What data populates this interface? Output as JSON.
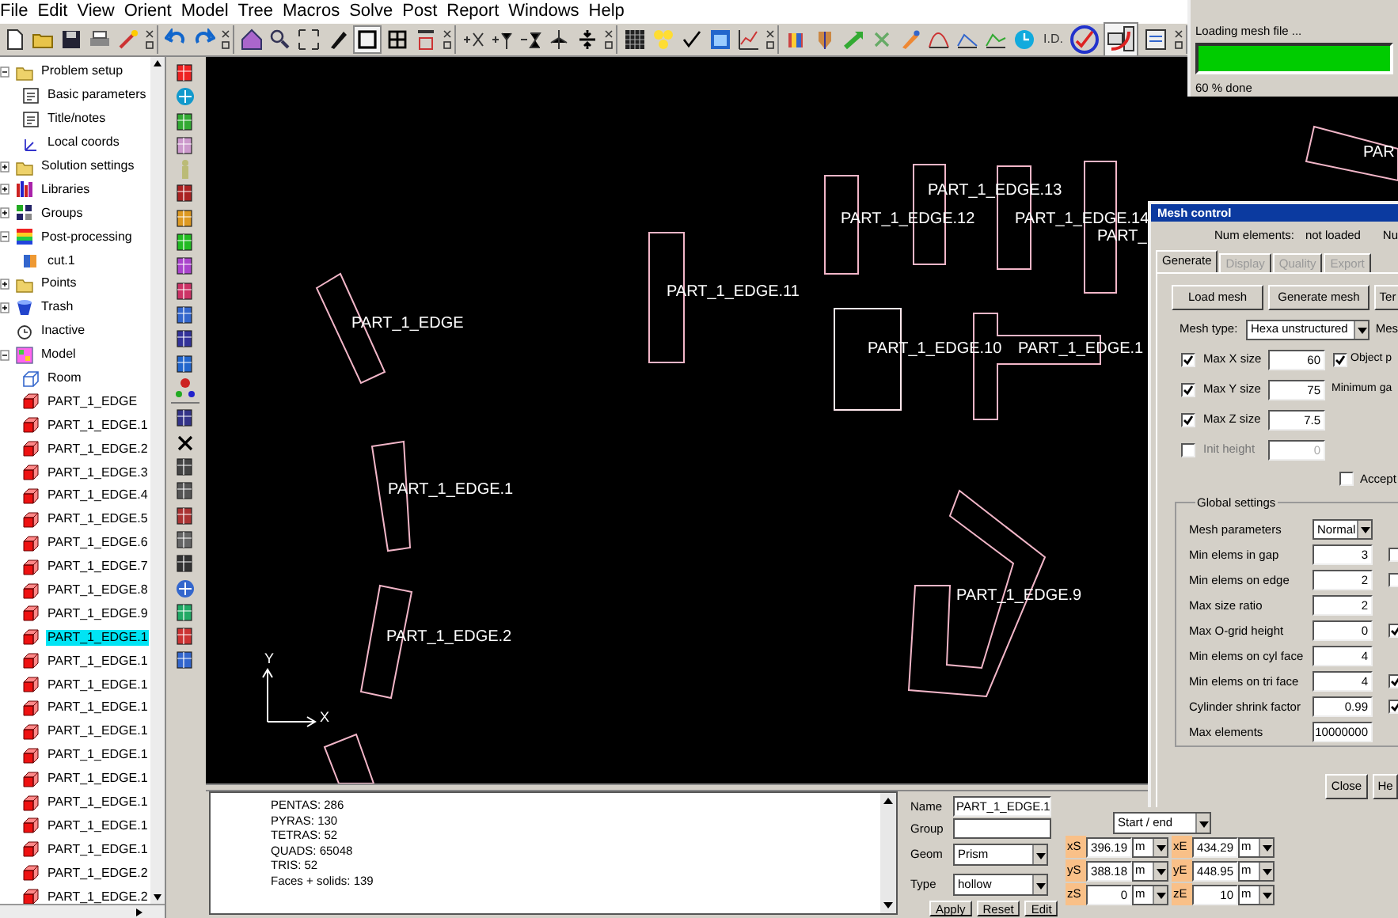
{
  "menu": [
    "File",
    "Edit",
    "View",
    "Orient",
    "Model",
    "Tree",
    "Macros",
    "Solve",
    "Post",
    "Report",
    "Windows",
    "Help"
  ],
  "toolbar": {
    "text_button": "I.D."
  },
  "progress": {
    "title": "Loading mesh file ...",
    "level": 1,
    "status": "60 % done"
  },
  "tree": [
    {
      "label": "Problem setup",
      "kind": "folder",
      "expanded": true,
      "selected": false,
      "children": [
        {
          "label": "Basic parameters",
          "kind": "page",
          "selected": false
        },
        {
          "label": "Title/notes",
          "kind": "page",
          "selected": false
        },
        {
          "label": "Local coords",
          "kind": "axes",
          "selected": false
        }
      ]
    },
    {
      "label": "Solution settings",
      "kind": "folder",
      "expanded": false,
      "selected": false
    },
    {
      "label": "Libraries",
      "kind": "books",
      "expanded": false,
      "selected": false
    },
    {
      "label": "Groups",
      "kind": "groups",
      "expanded": false,
      "selected": false
    },
    {
      "label": "Post-processing",
      "kind": "colormap",
      "expanded": true,
      "selected": false,
      "children": [
        {
          "label": "cut.1",
          "kind": "cut",
          "selected": false
        }
      ]
    },
    {
      "label": "Points",
      "kind": "folder",
      "expanded": false,
      "selected": false
    },
    {
      "label": "Trash",
      "kind": "trash",
      "expanded": false,
      "selected": false
    },
    {
      "label": "Inactive",
      "kind": "inactive",
      "selected": false
    },
    {
      "label": "Model",
      "kind": "model",
      "expanded": true,
      "selected": false,
      "children": [
        {
          "label": "Room",
          "kind": "room",
          "selected": false
        },
        {
          "label": "PART_1_EDGE",
          "kind": "block",
          "selected": false
        },
        {
          "label": "PART_1_EDGE.1",
          "kind": "block",
          "selected": false
        },
        {
          "label": "PART_1_EDGE.2",
          "kind": "block",
          "selected": false
        },
        {
          "label": "PART_1_EDGE.3",
          "kind": "block",
          "selected": false
        },
        {
          "label": "PART_1_EDGE.4",
          "kind": "block",
          "selected": false
        },
        {
          "label": "PART_1_EDGE.5",
          "kind": "block",
          "selected": false
        },
        {
          "label": "PART_1_EDGE.6",
          "kind": "block",
          "selected": false
        },
        {
          "label": "PART_1_EDGE.7",
          "kind": "block",
          "selected": false
        },
        {
          "label": "PART_1_EDGE.8",
          "kind": "block",
          "selected": false
        },
        {
          "label": "PART_1_EDGE.9",
          "kind": "block",
          "selected": false
        },
        {
          "label": "PART_1_EDGE.1",
          "kind": "block",
          "selected": true
        },
        {
          "label": "PART_1_EDGE.1",
          "kind": "block",
          "selected": false
        },
        {
          "label": "PART_1_EDGE.1",
          "kind": "block",
          "selected": false
        },
        {
          "label": "PART_1_EDGE.1",
          "kind": "block",
          "selected": false
        },
        {
          "label": "PART_1_EDGE.1",
          "kind": "block",
          "selected": false
        },
        {
          "label": "PART_1_EDGE.1",
          "kind": "block",
          "selected": false
        },
        {
          "label": "PART_1_EDGE.1",
          "kind": "block",
          "selected": false
        },
        {
          "label": "PART_1_EDGE.1",
          "kind": "block",
          "selected": false
        },
        {
          "label": "PART_1_EDGE.1",
          "kind": "block",
          "selected": false
        },
        {
          "label": "PART_1_EDGE.1",
          "kind": "block",
          "selected": false
        },
        {
          "label": "PART_1_EDGE.2",
          "kind": "block",
          "selected": false
        },
        {
          "label": "PART_1_EDGE.2",
          "kind": "block",
          "selected": false
        }
      ]
    }
  ],
  "canvas": {
    "parts": [
      "PART_1_EDGE",
      "PART_1_EDGE.1",
      "PART_1_EDGE.2",
      "PART_1_EDGE.11",
      "PART_1_EDGE.12",
      "PART_1_EDGE.13",
      "PART_1_EDGE.14",
      "PART_1_EDGE.10",
      "PART_1_EDGE.1",
      "PART_1_EDGE.9",
      "PART_",
      "PAR"
    ],
    "axis_y": "Y",
    "axis_x": "X"
  },
  "mesh_control": {
    "title": "Mesh control",
    "num_elements_label": "Num elements:",
    "num_elements_value": "not loaded",
    "column_3": "Nu",
    "tabs": [
      {
        "label": "Generate",
        "selected": true,
        "disabled": false
      },
      {
        "label": "Display",
        "selected": false,
        "disabled": true
      },
      {
        "label": "Quality",
        "selected": false,
        "disabled": true
      },
      {
        "label": "Export",
        "selected": false,
        "disabled": true
      }
    ],
    "buttons": [
      "Load mesh",
      "Generate mesh",
      "Ter"
    ],
    "mesh_type": {
      "label": "Mesh type:",
      "value": "Hexa unstructured",
      "right_label": "Mes"
    },
    "size_rows": [
      {
        "label": "Max X size",
        "checked": true,
        "value": "60",
        "disabled": false
      },
      {
        "label": "Max Y size",
        "checked": true,
        "value": "75",
        "disabled": false
      },
      {
        "label": "Max Z size",
        "checked": true,
        "value": "7.5",
        "disabled": false
      },
      {
        "label": "Init height",
        "checked": false,
        "value": "0",
        "disabled": true
      }
    ],
    "object_checkbox": {
      "label": "Object p",
      "checked": true
    },
    "minimum_gap_label": "Minimum ga",
    "accept_checkbox": {
      "label": "Accept",
      "checked": false
    },
    "global_settings": {
      "title": "Global settings",
      "mesh_parameters": {
        "label": "Mesh parameters",
        "value": "Normal"
      },
      "rows": [
        {
          "label": "Min elems in gap",
          "value": "3",
          "side_checked": false
        },
        {
          "label": "Min elems on edge",
          "value": "2",
          "side_checked": false
        },
        {
          "label": "Max size ratio",
          "value": "2"
        },
        {
          "label": "Max O-grid height",
          "value": "0",
          "side_checked": true
        },
        {
          "label": "Min elems on cyl face",
          "value": "4"
        },
        {
          "label": "Min elems on tri face",
          "value": "4",
          "side_checked": true
        },
        {
          "label": "Cylinder shrink factor",
          "value": "0.99",
          "side_checked": true
        },
        {
          "label": "Max elements",
          "value": "10000000"
        }
      ]
    },
    "footer_buttons": [
      "Close",
      "He"
    ]
  },
  "messages": [
    "PENTAS: 286",
    "PYRAS: 130",
    "TETRAS: 52",
    "QUADS: 65048",
    "TRIS: 52",
    "Faces + solids: 139"
  ],
  "properties": {
    "name": {
      "label": "Name",
      "value": "PART_1_EDGE.1"
    },
    "group": {
      "label": "Group"
    },
    "geom": {
      "label": "Geom",
      "value": "Prism"
    },
    "type": {
      "label": "Type",
      "value": "hollow"
    },
    "buttons": [
      "Apply",
      "Reset",
      "Edit"
    ],
    "position_mode": "Start / end",
    "coords": [
      {
        "label": "xS",
        "value": "396.19",
        "unit": "m"
      },
      {
        "label": "xE",
        "value": "434.29",
        "unit": "m"
      },
      {
        "label": "yS",
        "value": "388.18",
        "unit": "m"
      },
      {
        "label": "yE",
        "value": "448.95",
        "unit": "m"
      },
      {
        "label": "zS",
        "value": "0",
        "unit": "m"
      },
      {
        "label": "zE",
        "value": "10",
        "unit": "m"
      }
    ]
  }
}
